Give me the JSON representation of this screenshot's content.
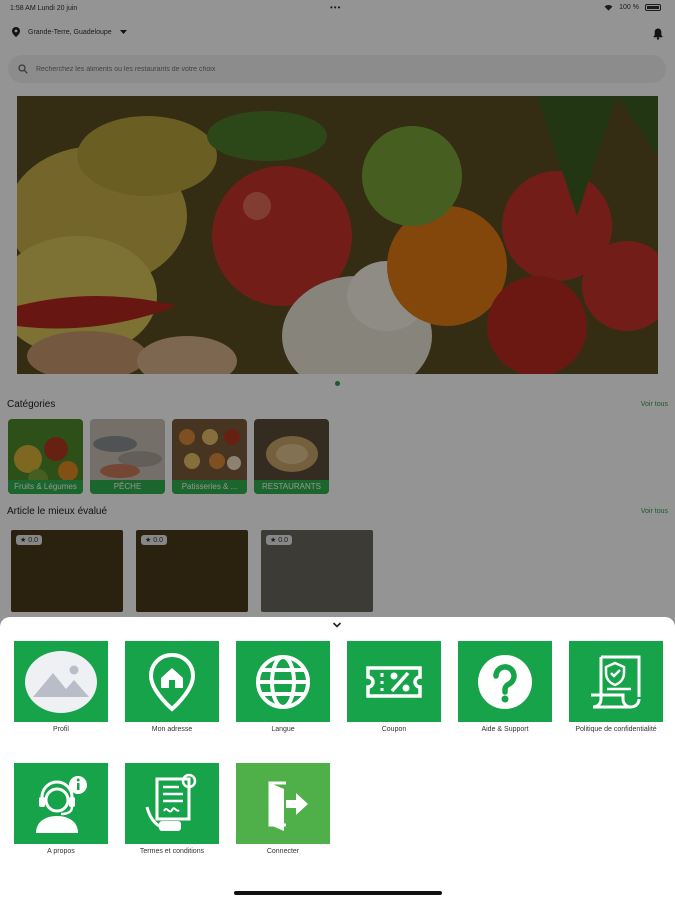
{
  "status_bar": {
    "time_date": "1:58 AM  Lundi 20 juin",
    "dots": "•••",
    "battery": "100 %"
  },
  "location": {
    "text": "Grande-Terre, Guadeloupe"
  },
  "search": {
    "placeholder": "Recherchez les aliments ou les restaurants de votre choix"
  },
  "categories": {
    "title": "Catégories",
    "see_all": "Voir tous",
    "items": [
      {
        "label": "Fruits & Légumes"
      },
      {
        "label": "PÊCHE"
      },
      {
        "label": "Patisseries & ..."
      },
      {
        "label": "RESTAURANTS"
      }
    ]
  },
  "articles": {
    "title": "Article le mieux évalué",
    "see_all": "Voir tous",
    "items": [
      {
        "rating": "0.0"
      },
      {
        "rating": "0.0"
      },
      {
        "rating": "0.0"
      }
    ]
  },
  "menu": {
    "items": [
      {
        "label": "Profil",
        "icon": "image-placeholder-icon"
      },
      {
        "label": "Mon adresse",
        "icon": "home-pin-icon"
      },
      {
        "label": "Langue",
        "icon": "globe-icon"
      },
      {
        "label": "Coupon",
        "icon": "coupon-icon"
      },
      {
        "label": "Aide & Support",
        "icon": "help-icon"
      },
      {
        "label": "Politique de confidentialité",
        "icon": "privacy-policy-icon"
      },
      {
        "label": "A propos",
        "icon": "support-agent-icon"
      },
      {
        "label": "Termes et conditions",
        "icon": "terms-document-icon"
      },
      {
        "label": "Connecter",
        "icon": "login-door-icon"
      }
    ]
  },
  "colors": {
    "accent": "#16a34a",
    "connect_tile": "#4fb04a"
  }
}
